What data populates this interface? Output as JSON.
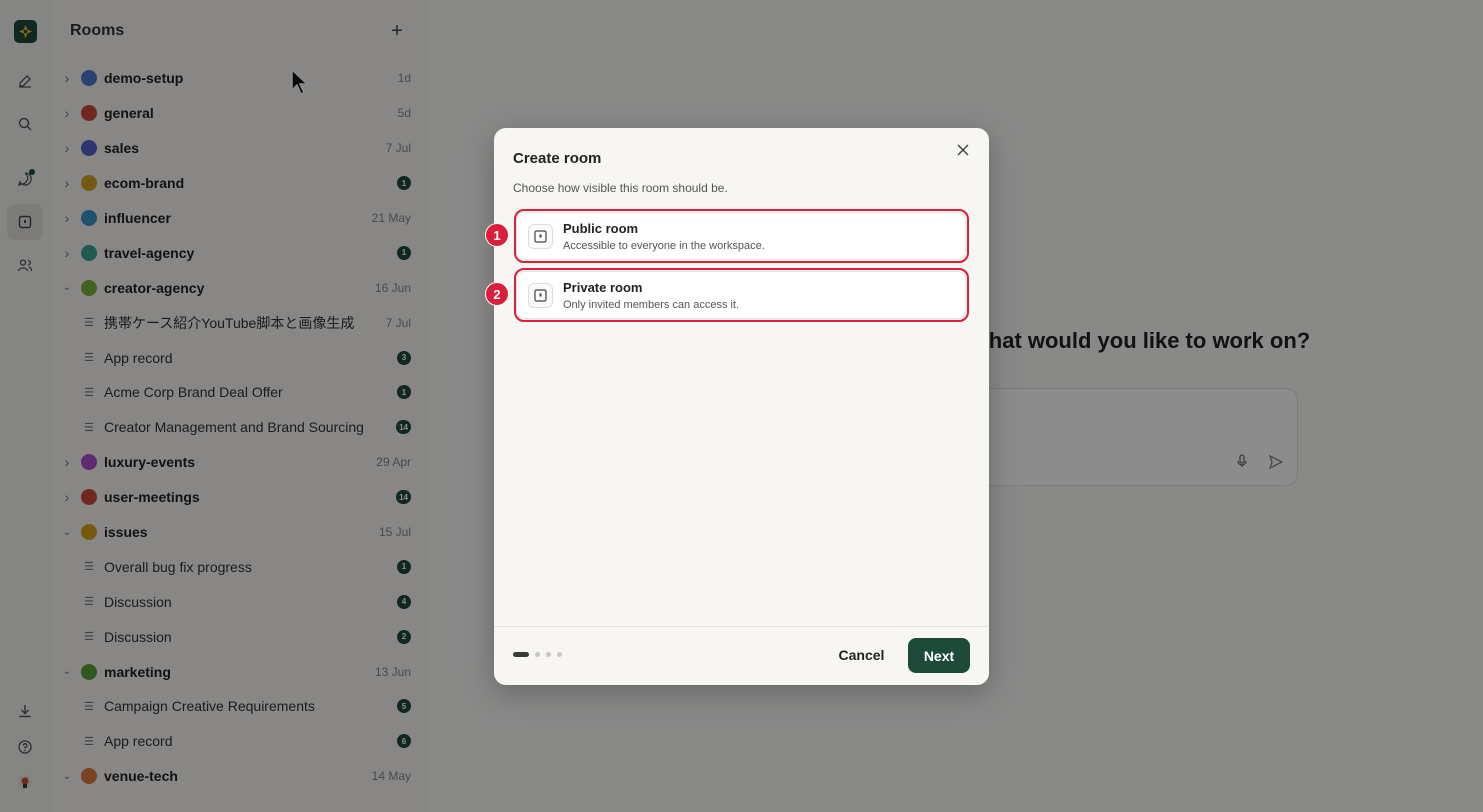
{
  "sidebar": {
    "title": "Rooms",
    "add_label": "+",
    "rows": [
      {
        "kind": "room",
        "expanded": false,
        "name": "demo-setup",
        "color": "#4a7bd0",
        "meta": "1d"
      },
      {
        "kind": "room",
        "expanded": false,
        "name": "general",
        "color": "#d0473a",
        "meta": "5d"
      },
      {
        "kind": "room",
        "expanded": false,
        "name": "sales",
        "color": "#5560c9",
        "meta": "7 Jul"
      },
      {
        "kind": "room",
        "expanded": false,
        "name": "ecom-brand",
        "color": "#d6a21f",
        "badge": "1"
      },
      {
        "kind": "room",
        "expanded": false,
        "name": "influencer",
        "color": "#3a95c6",
        "meta": "21 May"
      },
      {
        "kind": "room",
        "expanded": false,
        "name": "travel-agency",
        "color": "#3aa58e",
        "badge": "1"
      },
      {
        "kind": "room",
        "expanded": true,
        "name": "creator-agency",
        "color": "#7bb33a",
        "meta": "16 Jun"
      },
      {
        "kind": "doc",
        "name": "携帯ケース紹介YouTube脚本と画像生成",
        "meta": "7 Jul"
      },
      {
        "kind": "doc",
        "name": "App record",
        "badge": "3"
      },
      {
        "kind": "doc",
        "name": "Acme Corp Brand Deal Offer",
        "badge": "1"
      },
      {
        "kind": "doc",
        "name": "Creator Management and Brand Sourcing",
        "badge": "14"
      },
      {
        "kind": "room",
        "expanded": false,
        "name": "luxury-events",
        "color": "#b04fd0",
        "meta": "29 Apr"
      },
      {
        "kind": "room",
        "expanded": false,
        "name": "user-meetings",
        "color": "#d0473a",
        "badge": "14"
      },
      {
        "kind": "room",
        "expanded": true,
        "name": "issues",
        "color": "#d6a21f",
        "meta": "15 Jul"
      },
      {
        "kind": "doc",
        "name": "Overall bug fix progress",
        "badge": "1"
      },
      {
        "kind": "doc",
        "name": "Discussion",
        "badge": "4"
      },
      {
        "kind": "doc",
        "name": "Discussion",
        "badge": "2"
      },
      {
        "kind": "room",
        "expanded": true,
        "name": "marketing",
        "color": "#5aa33a",
        "meta": "13 Jun"
      },
      {
        "kind": "doc",
        "name": "Campaign Creative Requirements",
        "badge": "5"
      },
      {
        "kind": "doc",
        "name": "App record",
        "badge": "6"
      },
      {
        "kind": "room",
        "expanded": true,
        "name": "venue-tech",
        "color": "#e07a3a",
        "meta": "14 May"
      }
    ]
  },
  "main": {
    "question": "What would you like to work on?"
  },
  "modal": {
    "title": "Create room",
    "subtitle": "Choose how visible this room should be.",
    "options": [
      {
        "title": "Public room",
        "description": "Accessible to everyone in the workspace.",
        "marker": "1"
      },
      {
        "title": "Private room",
        "description": "Only invited members can access it.",
        "marker": "2"
      }
    ],
    "cancel_label": "Cancel",
    "next_label": "Next",
    "step_count": 4,
    "current_step": 1
  },
  "colors": {
    "accent": "#1e4a3a",
    "highlight": "#d91f3a"
  }
}
